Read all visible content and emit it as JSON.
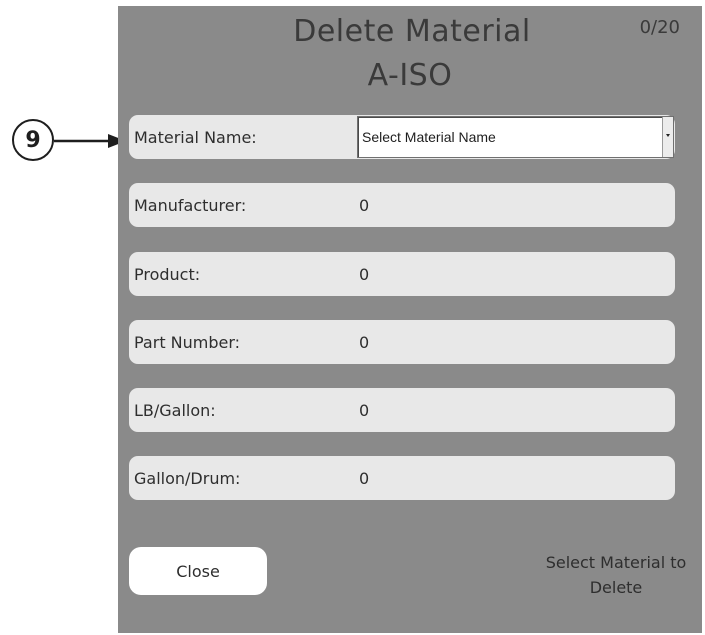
{
  "dialog": {
    "title_line1": "Delete Material",
    "title_line2": "A-ISO",
    "counter": "0/20"
  },
  "fields": {
    "material_name": {
      "label": "Material Name:",
      "select_value": "Select Material Name"
    },
    "manufacturer": {
      "label": "Manufacturer:",
      "value": "0"
    },
    "product": {
      "label": "Product:",
      "value": "0"
    },
    "part_number": {
      "label": "Part Number:",
      "value": "0"
    },
    "lb_gallon": {
      "label": "LB/Gallon:",
      "value": "0"
    },
    "gallon_drum": {
      "label": "Gallon/Drum:",
      "value": "0"
    }
  },
  "footer": {
    "close_label": "Close",
    "status_line1": "Select Material to",
    "status_line2": "Delete"
  },
  "callout": {
    "number": "9",
    "icon": "arrow-right-icon"
  },
  "colors": {
    "dialog_bg": "#8a8a8a",
    "row_bg": "#e8e8e8",
    "text": "#2e2e2e"
  }
}
